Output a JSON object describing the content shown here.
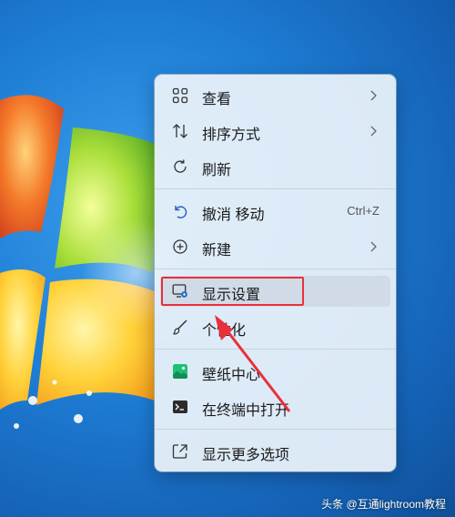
{
  "menu": {
    "items": [
      {
        "label": "查看",
        "icon": "grid-icon",
        "submenu": true
      },
      {
        "label": "排序方式",
        "icon": "sort-icon",
        "submenu": true
      },
      {
        "label": "刷新",
        "icon": "refresh-icon"
      },
      {
        "label": "撤消 移动",
        "icon": "undo-icon",
        "shortcut": "Ctrl+Z"
      },
      {
        "label": "新建",
        "icon": "new-icon",
        "submenu": true
      },
      {
        "label": "显示设置",
        "icon": "display-settings-icon",
        "highlighted": true
      },
      {
        "label": "个性化",
        "icon": "brush-icon"
      },
      {
        "label": "壁纸中心",
        "icon": "wallpaper-icon"
      },
      {
        "label": "在终端中打开",
        "icon": "terminal-icon"
      },
      {
        "label": "显示更多选项",
        "icon": "more-options-icon"
      }
    ]
  },
  "watermark": "头条 @互通lightroom教程",
  "colors": {
    "accent": "#e8303a",
    "desktop_blue": "#1f7fd6",
    "menu_bg": "#ecf3fa"
  }
}
